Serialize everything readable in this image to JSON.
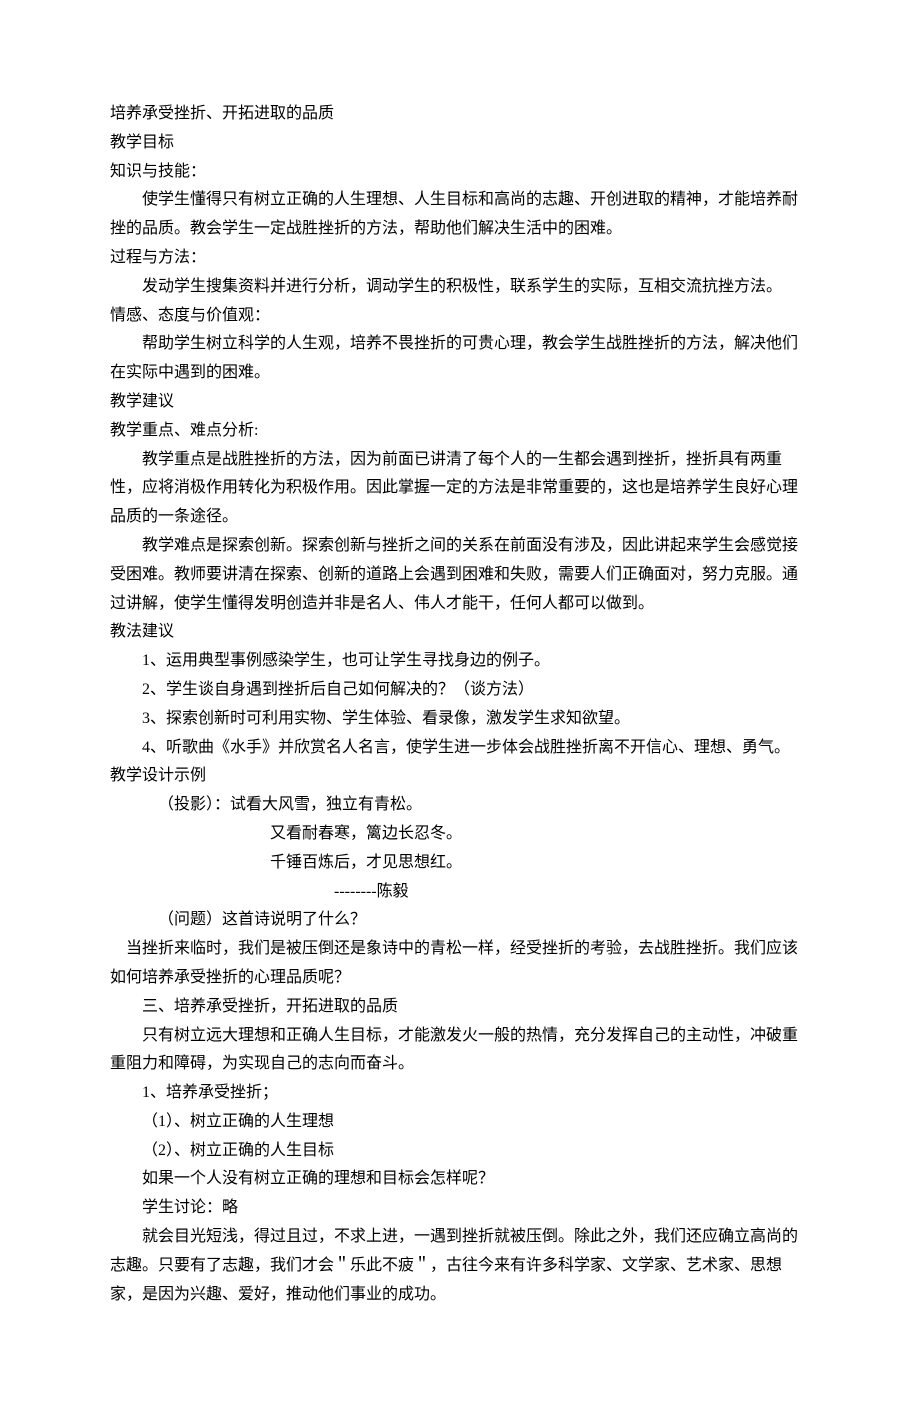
{
  "title": "培养承受挫折、开拓进取的品质",
  "sections": {
    "objectives_header": "教学目标",
    "knowledge_skills": {
      "header": "知识与技能：",
      "body": "使学生懂得只有树立正确的人生理想、人生目标和高尚的志趣、开创进取的精神，才能培养耐挫的品质。教会学生一定战胜挫折的方法，帮助他们解决生活中的困难。"
    },
    "process_method": {
      "header": "过程与方法：",
      "body": "发动学生搜集资料并进行分析，调动学生的积极性，联系学生的实际，互相交流抗挫方法。"
    },
    "emotion": {
      "header": "情感、态度与价值观：",
      "body": "帮助学生树立科学的人生观，培养不畏挫折的可贵心理，教会学生战胜挫折的方法，解决他们在实际中遇到的困难。"
    },
    "suggestions_header": "教学建议",
    "focus_header": "教学重点、难点分析:",
    "focus_body1": "教学重点是战胜挫折的方法，因为前面已讲清了每个人的一生都会遇到挫折，挫折具有两重性，应将消极作用转化为积极作用。因此掌握一定的方法是非常重要的，这也是培养学生良好心理品质的一条途径。",
    "focus_body2": "教学难点是探索创新。探索创新与挫折之间的关系在前面没有涉及，因此讲起来学生会感觉接受困难。教师要讲清在探索、创新的道路上会遇到困难和失败，需要人们正确面对，努力克服。通过讲解，使学生懂得发明创造并非是名人、伟人才能干，任何人都可以做到。",
    "method_header": "教法建议",
    "methods": [
      "1、运用典型事例感染学生，也可让学生寻找身边的例子。",
      "2、学生谈自身遇到挫折后自己如何解决的？（谈方法）",
      "3、探索创新时可利用实物、学生体验、看录像，激发学生求知欲望。",
      "4、听歌曲《水手》并欣赏名人名言，使学生进一步体会战胜挫折离不开信心、理想、勇气。"
    ],
    "design_header": "教学设计示例",
    "projection_label": "（投影）：",
    "poem": [
      "试看大风雪，独立有青松。",
      "又看耐春寒，篱边长忍冬。",
      "千锤百炼后，才见思想红。"
    ],
    "poem_author": "--------陈毅",
    "question": "（问题）这首诗说明了什么？",
    "design_body1": "当挫折来临时，我们是被压倒还是象诗中的青松一样，经受挫折的考验，去战胜挫折。我们应该如何培养承受挫折的心理品质呢？",
    "section3_header": "三、培养承受挫折，开拓进取的品质",
    "section3_body": "只有树立远大理想和正确人生目标，才能激发火一般的热情，充分发挥自己的主动性，冲破重重阻力和障碍，为实现自己的志向而奋斗。",
    "cultivate_header": "1、培养承受挫折；",
    "point1": "（1）、树立正确的人生理想",
    "point2": "（2）、树立正确的人生目标",
    "discuss_q": "如果一个人没有树立正确的理想和目标会怎样呢？",
    "discuss_label": "学生讨论：略",
    "conclusion": "就会目光短浅，得过且过，不求上进，一遇到挫折就被压倒。除此之外，我们还应确立高尚的志趣。只要有了志趣，我们才会＂乐此不疲＂，古往今来有许多科学家、文学家、艺术家、思想家，是因为兴趣、爱好，推动他们事业的成功。"
  }
}
